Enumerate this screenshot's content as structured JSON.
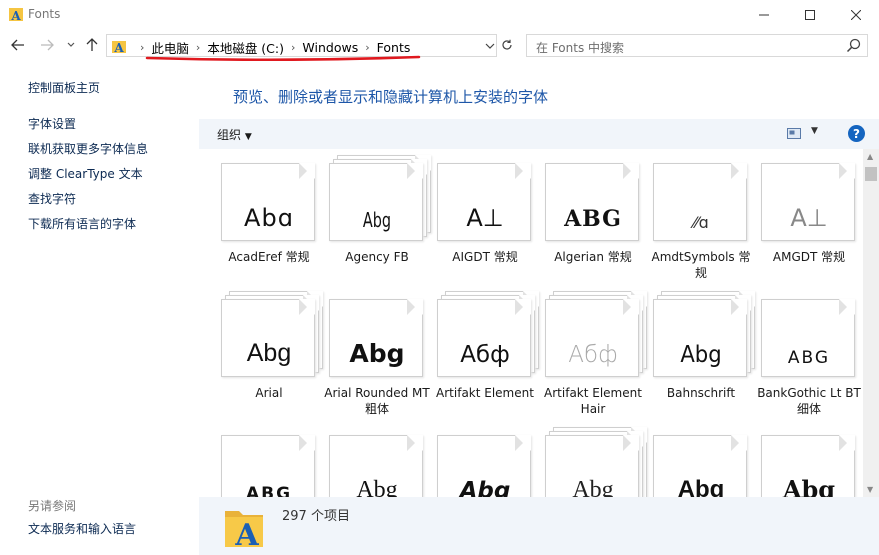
{
  "window": {
    "title": "Fonts"
  },
  "address": {
    "crumbs": [
      "此电脑",
      "本地磁盘 (C:)",
      "Windows",
      "Fonts"
    ]
  },
  "search": {
    "placeholder": "在 Fonts 中搜索"
  },
  "sidebar": {
    "home": "控制面板主页",
    "links": [
      "字体设置",
      "联机获取更多字体信息",
      "调整 ClearType 文本",
      "查找字符",
      "下载所有语言的字体"
    ],
    "see_also_title": "另请参阅",
    "see_also": [
      "文本服务和输入语言"
    ]
  },
  "main": {
    "heading": "预览、删除或者显示和隐藏计算机上安装的字体",
    "organize_label": "组织",
    "help_label": "?"
  },
  "fonts": [
    {
      "name": "AcadEref 常规",
      "sample": "Abɑ",
      "stack": false
    },
    {
      "name": "Agency FB",
      "sample": "Abg",
      "stack": true
    },
    {
      "name": "AIGDT 常规",
      "sample": "A⊥",
      "stack": false
    },
    {
      "name": "Algerian 常规",
      "sample": "ABG",
      "stack": false
    },
    {
      "name": "AmdtSymbols 常规",
      "sample": "⁄⁄ɑ",
      "stack": false
    },
    {
      "name": "AMGDT 常规",
      "sample": "A⊥",
      "stack": false
    },
    {
      "name": "Arial",
      "sample": "Abg",
      "stack": true
    },
    {
      "name": "Arial Rounded MT 粗体",
      "sample": "Abg",
      "stack": false
    },
    {
      "name": "Artifakt Element",
      "sample": "Абф",
      "stack": true
    },
    {
      "name": "Artifakt Element Hair",
      "sample": "Абф",
      "stack": true
    },
    {
      "name": "Bahnschrift",
      "sample": "Abg",
      "stack": true
    },
    {
      "name": "BankGothic Lt BT 细体",
      "sample": "ABG",
      "stack": false
    },
    {
      "name": "",
      "sample": "ABG",
      "stack": false
    },
    {
      "name": "",
      "sample": "Abg",
      "stack": false
    },
    {
      "name": "",
      "sample": "Abg",
      "stack": false
    },
    {
      "name": "",
      "sample": "Abg",
      "stack": true
    },
    {
      "name": "",
      "sample": "Abg",
      "stack": false
    },
    {
      "name": "",
      "sample": "Abg",
      "stack": false
    }
  ],
  "status": {
    "count": "297 个项目"
  },
  "colors": {
    "accent": "#1e57a8",
    "underline": "#e0191f",
    "toolbar_bg": "#f1f5fa"
  }
}
